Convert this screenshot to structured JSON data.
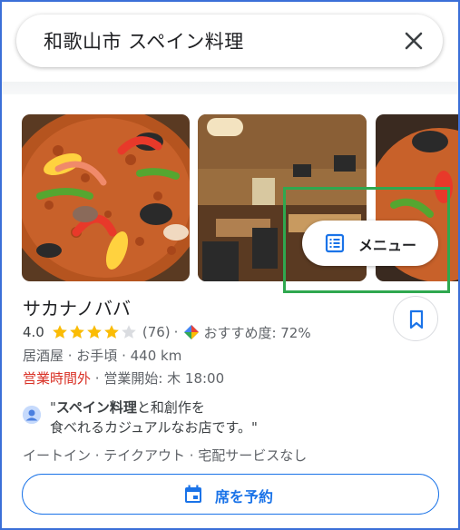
{
  "search": {
    "query": "和歌山市 スペイン料理"
  },
  "menu_chip": {
    "label": "メニュー"
  },
  "place": {
    "name": "サカナノババ",
    "rating": "4.0",
    "star_fill": 0.8,
    "review_count": "(76)",
    "separator": "·",
    "recommend": "おすすめ度: 72%",
    "type_line": "居酒屋 · お手頃 · 440 km",
    "status": "営業時間外",
    "opening": " · 営業開始: 木 18:00"
  },
  "review": {
    "open_quote": "\"",
    "highlight": "スペイン料理",
    "rest_line1": "と和創作を",
    "line2": "食べれるカジュアルなお店です。\""
  },
  "services": "イートイン · テイクアウト · 宅配サービスなし",
  "reserve": {
    "label": "席を予約"
  },
  "colors": {
    "accent": "#1a73e8",
    "star": "#fbbc04",
    "closed": "#d93025",
    "highlight_box": "#2fa84f"
  }
}
